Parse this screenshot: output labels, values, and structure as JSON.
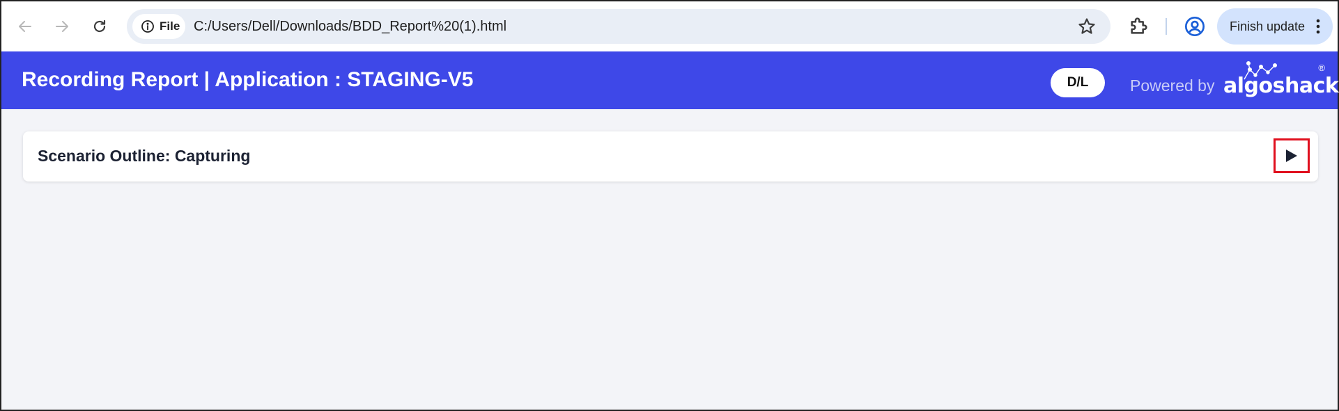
{
  "browser": {
    "site_chip_label": "File",
    "url": "C:/Users/Dell/Downloads/BDD_Report%20(1).html",
    "finish_update_label": "Finish update",
    "icons": {
      "back": "arrow-left-icon",
      "forward": "arrow-right-icon",
      "reload": "reload-icon",
      "site_info": "info-icon",
      "bookmark": "star-icon",
      "extensions": "puzzle-icon",
      "profile": "profile-icon",
      "menu": "more-vert-icon"
    }
  },
  "header": {
    "title": "Recording Report | Application : STAGING-V5",
    "dl_button_label": "D/L",
    "powered_by": "Powered by",
    "brand_name": "algoshack",
    "brand_registered_mark": "®",
    "background_color": "#3e48e8"
  },
  "main": {
    "scenario": {
      "title": "Scenario Outline: Capturing",
      "expand_icon": "play-icon",
      "highlight_color": "#e0101e"
    }
  }
}
